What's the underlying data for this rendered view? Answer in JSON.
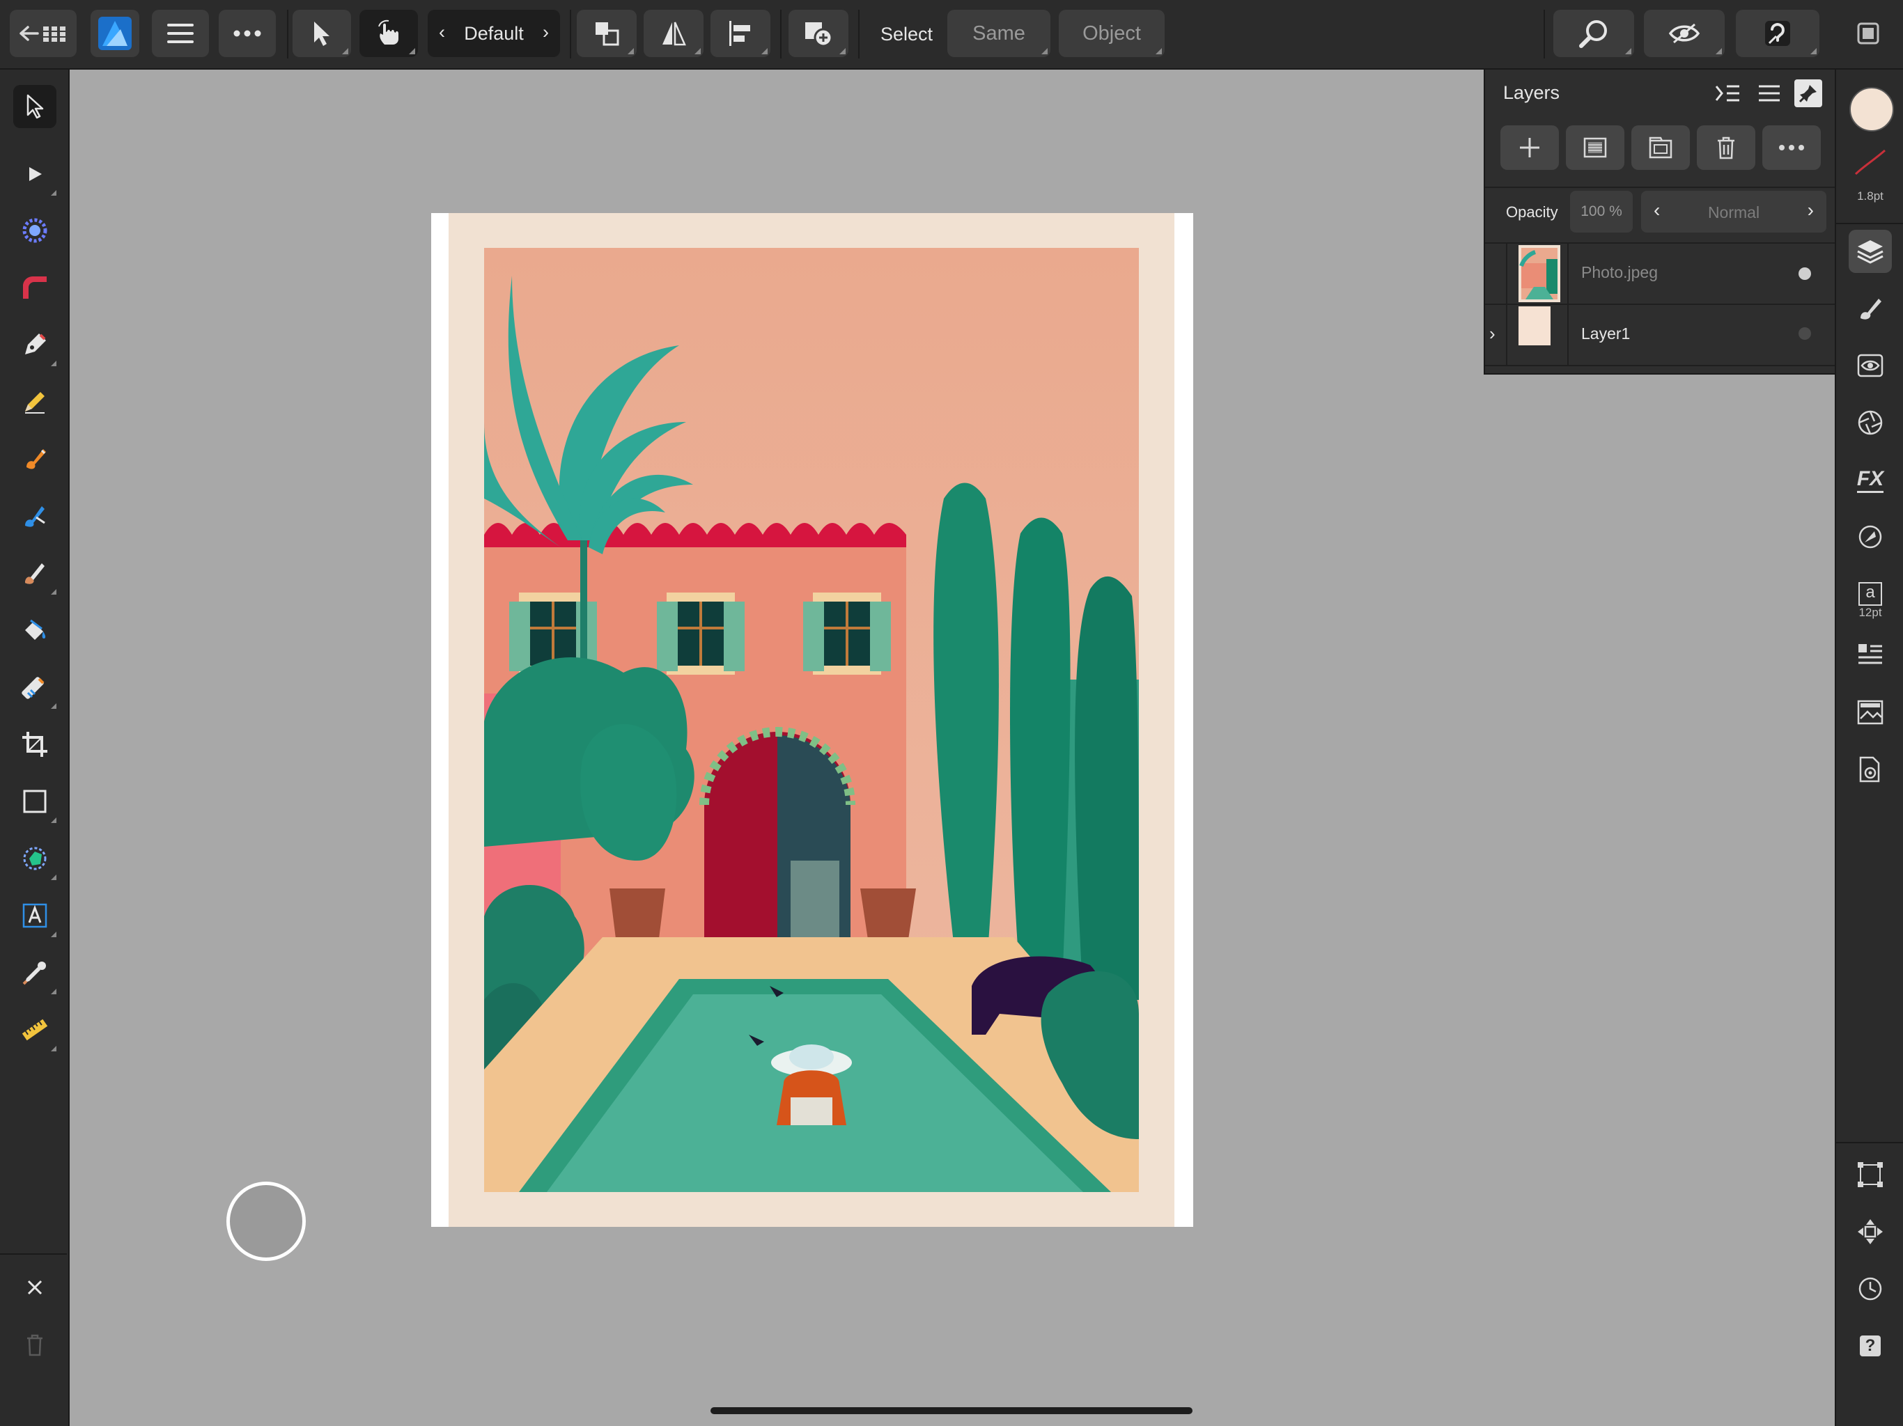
{
  "topbar": {
    "persona": "Default",
    "select_label": "Select",
    "same_label": "Same",
    "object_label": "Object"
  },
  "layers": {
    "title": "Layers",
    "opacity_label": "Opacity",
    "opacity_value": "100 %",
    "blend_mode": "Normal",
    "items": [
      {
        "name": "Photo.jpeg"
      },
      {
        "name": "Layer1"
      }
    ]
  },
  "rightbar": {
    "stroke_width": "1.8pt",
    "text_size": "12pt",
    "text_glyph": "a",
    "fx_label": "FX",
    "help_label": "?"
  },
  "colors": {
    "primary_fill": "#f3e2d3",
    "stroke": "#c8303a",
    "accent_blue": "#2f9bf0"
  }
}
